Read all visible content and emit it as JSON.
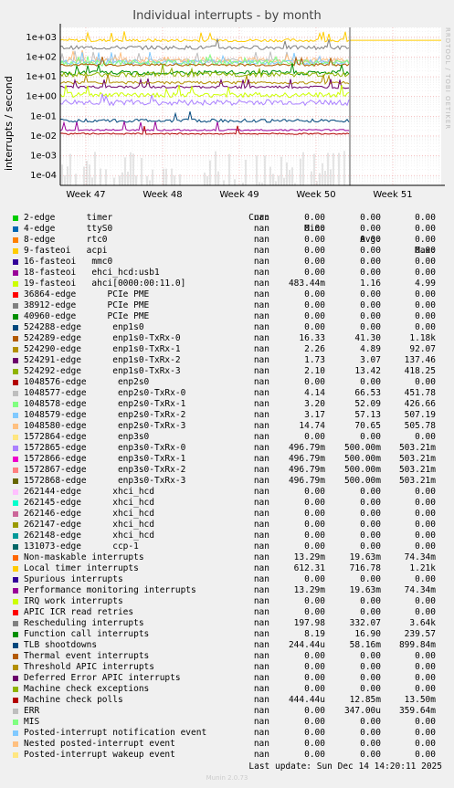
{
  "chart_data": {
    "type": "line",
    "title": "Individual interrupts - by month",
    "ylabel": "interrupts / second",
    "yscale": "log",
    "y_ticks": [
      "1e+03",
      "1e+02",
      "1e+01",
      "1e+00",
      "1e-01",
      "1e-02",
      "1e-03",
      "1e-04"
    ],
    "x_ticks": [
      "Week 47",
      "Week 48",
      "Week 49",
      "Week 50",
      "Week 51"
    ],
    "columns": [
      "Cur:",
      "Min:",
      "Avg:",
      "Max:"
    ],
    "series": [
      {
        "name": "2-edge      timer",
        "color": "#00cc00",
        "cur": "nan",
        "min": "0.00",
        "avg": "0.00",
        "max": "0.00"
      },
      {
        "name": "4-edge      ttyS0",
        "color": "#0066b3",
        "cur": "nan",
        "min": "0.00",
        "avg": "0.00",
        "max": "0.00"
      },
      {
        "name": "8-edge      rtc0",
        "color": "#ff8000",
        "cur": "nan",
        "min": "0.00",
        "avg": "0.00",
        "max": "0.00"
      },
      {
        "name": "9-fasteoi   acpi",
        "color": "#ffcc00",
        "cur": "nan",
        "min": "0.00",
        "avg": "0.00",
        "max": "0.00"
      },
      {
        "name": "16-fasteoi   mmc0",
        "color": "#330099",
        "cur": "nan",
        "min": "0.00",
        "avg": "0.00",
        "max": "0.00"
      },
      {
        "name": "18-fasteoi   ehci_hcd:usb1",
        "color": "#990099",
        "cur": "nan",
        "min": "0.00",
        "avg": "0.00",
        "max": "0.00"
      },
      {
        "name": "19-fasteoi   ahci[0000:00:11.0]",
        "color": "#ccff00",
        "cur": "nan",
        "min": "483.44m",
        "avg": "1.16",
        "max": "4.99"
      },
      {
        "name": "36864-edge      PCIe PME",
        "color": "#ff0000",
        "cur": "nan",
        "min": "0.00",
        "avg": "0.00",
        "max": "0.00"
      },
      {
        "name": "38912-edge      PCIe PME",
        "color": "#808080",
        "cur": "nan",
        "min": "0.00",
        "avg": "0.00",
        "max": "0.00"
      },
      {
        "name": "40960-edge      PCIe PME",
        "color": "#008f00",
        "cur": "nan",
        "min": "0.00",
        "avg": "0.00",
        "max": "0.00"
      },
      {
        "name": "524288-edge      enp1s0",
        "color": "#00487d",
        "cur": "nan",
        "min": "0.00",
        "avg": "0.00",
        "max": "0.00"
      },
      {
        "name": "524289-edge      enp1s0-TxRx-0",
        "color": "#b35a00",
        "cur": "nan",
        "min": "16.33",
        "avg": "41.30",
        "max": "1.18k"
      },
      {
        "name": "524290-edge      enp1s0-TxRx-1",
        "color": "#b38f00",
        "cur": "nan",
        "min": "2.26",
        "avg": "4.89",
        "max": "92.07"
      },
      {
        "name": "524291-edge      enp1s0-TxRx-2",
        "color": "#6b006b",
        "cur": "nan",
        "min": "1.73",
        "avg": "3.07",
        "max": "137.46"
      },
      {
        "name": "524292-edge      enp1s0-TxRx-3",
        "color": "#8fb300",
        "cur": "nan",
        "min": "2.10",
        "avg": "13.42",
        "max": "418.25"
      },
      {
        "name": "1048576-edge      enp2s0",
        "color": "#b30000",
        "cur": "nan",
        "min": "0.00",
        "avg": "0.00",
        "max": "0.00"
      },
      {
        "name": "1048577-edge      enp2s0-TxRx-0",
        "color": "#bebebe",
        "cur": "nan",
        "min": "4.14",
        "avg": "66.53",
        "max": "451.78"
      },
      {
        "name": "1048578-edge      enp2s0-TxRx-1",
        "color": "#80ff80",
        "cur": "nan",
        "min": "3.20",
        "avg": "52.09",
        "max": "426.66"
      },
      {
        "name": "1048579-edge      enp2s0-TxRx-2",
        "color": "#80c9ff",
        "cur": "nan",
        "min": "3.17",
        "avg": "57.13",
        "max": "507.19"
      },
      {
        "name": "1048580-edge      enp2s0-TxRx-3",
        "color": "#ffc080",
        "cur": "nan",
        "min": "14.74",
        "avg": "70.65",
        "max": "505.78"
      },
      {
        "name": "1572864-edge      enp3s0",
        "color": "#ffe680",
        "cur": "nan",
        "min": "0.00",
        "avg": "0.00",
        "max": "0.00"
      },
      {
        "name": "1572865-edge      enp3s0-TxRx-0",
        "color": "#aa80ff",
        "cur": "nan",
        "min": "496.79m",
        "avg": "500.00m",
        "max": "503.21m"
      },
      {
        "name": "1572866-edge      enp3s0-TxRx-1",
        "color": "#ee00cc",
        "cur": "nan",
        "min": "496.79m",
        "avg": "500.00m",
        "max": "503.21m"
      },
      {
        "name": "1572867-edge      enp3s0-TxRx-2",
        "color": "#ff8080",
        "cur": "nan",
        "min": "496.79m",
        "avg": "500.00m",
        "max": "503.21m"
      },
      {
        "name": "1572868-edge      enp3s0-TxRx-3",
        "color": "#666600",
        "cur": "nan",
        "min": "496.79m",
        "avg": "500.00m",
        "max": "503.21m"
      },
      {
        "name": "262144-edge      xhci_hcd",
        "color": "#ffbfff",
        "cur": "nan",
        "min": "0.00",
        "avg": "0.00",
        "max": "0.00"
      },
      {
        "name": "262145-edge      xhci_hcd",
        "color": "#00ffcc",
        "cur": "nan",
        "min": "0.00",
        "avg": "0.00",
        "max": "0.00"
      },
      {
        "name": "262146-edge      xhci_hcd",
        "color": "#cc6699",
        "cur": "nan",
        "min": "0.00",
        "avg": "0.00",
        "max": "0.00"
      },
      {
        "name": "262147-edge      xhci_hcd",
        "color": "#999900",
        "cur": "nan",
        "min": "0.00",
        "avg": "0.00",
        "max": "0.00"
      },
      {
        "name": "262148-edge      xhci_hcd",
        "color": "#009999",
        "cur": "nan",
        "min": "0.00",
        "avg": "0.00",
        "max": "0.00"
      },
      {
        "name": "131073-edge      ccp-1",
        "color": "#006666",
        "cur": "nan",
        "min": "0.00",
        "avg": "0.00",
        "max": "0.00"
      },
      {
        "name": "Non-maskable interrupts",
        "color": "#ff6600",
        "cur": "nan",
        "min": "13.29m",
        "avg": "19.63m",
        "max": "74.34m"
      },
      {
        "name": "Local timer interrupts",
        "color": "#ffcc00",
        "cur": "nan",
        "min": "612.31",
        "avg": "716.78",
        "max": "1.21k"
      },
      {
        "name": "Spurious interrupts",
        "color": "#330099",
        "cur": "nan",
        "min": "0.00",
        "avg": "0.00",
        "max": "0.00"
      },
      {
        "name": "Performance monitoring interrupts",
        "color": "#990099",
        "cur": "nan",
        "min": "13.29m",
        "avg": "19.63m",
        "max": "74.34m"
      },
      {
        "name": "IRQ work interrupts",
        "color": "#ccff00",
        "cur": "nan",
        "min": "0.00",
        "avg": "0.00",
        "max": "0.00"
      },
      {
        "name": "APIC ICR read retries",
        "color": "#ff0000",
        "cur": "nan",
        "min": "0.00",
        "avg": "0.00",
        "max": "0.00"
      },
      {
        "name": "Rescheduling interrupts",
        "color": "#808080",
        "cur": "nan",
        "min": "197.98",
        "avg": "332.07",
        "max": "3.64k"
      },
      {
        "name": "Function call interrupts",
        "color": "#008f00",
        "cur": "nan",
        "min": "8.19",
        "avg": "16.90",
        "max": "239.57"
      },
      {
        "name": "TLB shootdowns",
        "color": "#00487d",
        "cur": "nan",
        "min": "244.44u",
        "avg": "58.16m",
        "max": "899.84m"
      },
      {
        "name": "Thermal event interrupts",
        "color": "#b35a00",
        "cur": "nan",
        "min": "0.00",
        "avg": "0.00",
        "max": "0.00"
      },
      {
        "name": "Threshold APIC interrupts",
        "color": "#b38f00",
        "cur": "nan",
        "min": "0.00",
        "avg": "0.00",
        "max": "0.00"
      },
      {
        "name": "Deferred Error APIC interrupts",
        "color": "#6b006b",
        "cur": "nan",
        "min": "0.00",
        "avg": "0.00",
        "max": "0.00"
      },
      {
        "name": "Machine check exceptions",
        "color": "#8fb300",
        "cur": "nan",
        "min": "0.00",
        "avg": "0.00",
        "max": "0.00"
      },
      {
        "name": "Machine check polls",
        "color": "#b30000",
        "cur": "nan",
        "min": "444.44u",
        "avg": "12.85m",
        "max": "13.50m"
      },
      {
        "name": "ERR",
        "color": "#bebebe",
        "cur": "nan",
        "min": "0.00",
        "avg": "347.00u",
        "max": "359.64m"
      },
      {
        "name": "MIS",
        "color": "#80ff80",
        "cur": "nan",
        "min": "0.00",
        "avg": "0.00",
        "max": "0.00"
      },
      {
        "name": "Posted-interrupt notification event",
        "color": "#80c9ff",
        "cur": "nan",
        "min": "0.00",
        "avg": "0.00",
        "max": "0.00"
      },
      {
        "name": "Nested posted-interrupt event",
        "color": "#ffc080",
        "cur": "nan",
        "min": "0.00",
        "avg": "0.00",
        "max": "0.00"
      },
      {
        "name": "Posted-interrupt wakeup event",
        "color": "#ffe680",
        "cur": "nan",
        "min": "0.00",
        "avg": "0.00",
        "max": "0.00"
      }
    ],
    "plotted_levels": [
      {
        "color": "#ffcc00",
        "value": 700
      },
      {
        "color": "#808080",
        "value": 300
      },
      {
        "color": "#bebebe",
        "value": 65
      },
      {
        "color": "#ffc080",
        "value": 70
      },
      {
        "color": "#80c9ff",
        "value": 55
      },
      {
        "color": "#80ff80",
        "value": 50
      },
      {
        "color": "#b35a00",
        "value": 40
      },
      {
        "color": "#008f00",
        "value": 16
      },
      {
        "color": "#8fb300",
        "value": 13
      },
      {
        "color": "#b38f00",
        "value": 5
      },
      {
        "color": "#6b006b",
        "value": 3
      },
      {
        "color": "#ccff00",
        "value": 1.2
      },
      {
        "color": "#aa80ff",
        "value": 0.5
      },
      {
        "color": "#00487d",
        "value": 0.06
      },
      {
        "color": "#990099",
        "value": 0.02
      },
      {
        "color": "#b30000",
        "value": 0.013
      }
    ]
  },
  "footer": {
    "last_update": "Last update: Sun Dec 14 14:20:11 2025",
    "munin": "Munin 2.0.73",
    "rrd": "RRDTOOL / TOBI OETIKER"
  }
}
